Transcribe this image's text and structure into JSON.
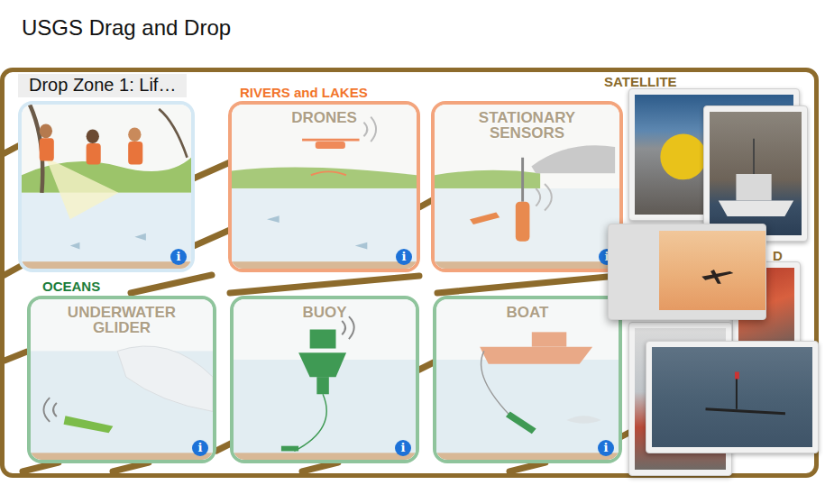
{
  "title": "USGS Drag and Drop",
  "drop_zone": {
    "label": "Drop Zone 1: Lif…"
  },
  "section_labels": [
    {
      "label": "RIVERS and LAKES",
      "color": "#f2752b"
    },
    {
      "label": "OCEANS",
      "color": "#1b7d3a"
    },
    {
      "label": "SATELLITE",
      "color": "#8a6a2a"
    },
    {
      "label": "D",
      "color": "#8a6a2a"
    }
  ],
  "top_row": [
    {
      "kind": "people",
      "color": "#d4e8f4",
      "info": "i"
    },
    {
      "kind": "drone",
      "title": "DRONES",
      "color": "#f3a47c",
      "info": "i"
    },
    {
      "kind": "sensor",
      "title": "STATIONARY SENSORS",
      "color": "#f3a47c",
      "info": "i"
    }
  ],
  "bottom_row": [
    {
      "kind": "glider",
      "title": "UNDERWATER GLIDER",
      "color": "#8fc49c",
      "info": "i"
    },
    {
      "kind": "buoy",
      "title": "BUOY",
      "color": "#8fc49c",
      "info": "i"
    },
    {
      "kind": "boat",
      "title": "BOAT",
      "color": "#8fc49c",
      "info": "i"
    }
  ],
  "photos": [
    {
      "kind": "buoy",
      "selected": false
    },
    {
      "kind": "boat",
      "selected": false
    },
    {
      "kind": "red",
      "selected": false
    },
    {
      "kind": "person",
      "selected": false
    },
    {
      "kind": "plane",
      "selected": true
    },
    {
      "kind": "glider",
      "selected": false
    }
  ]
}
